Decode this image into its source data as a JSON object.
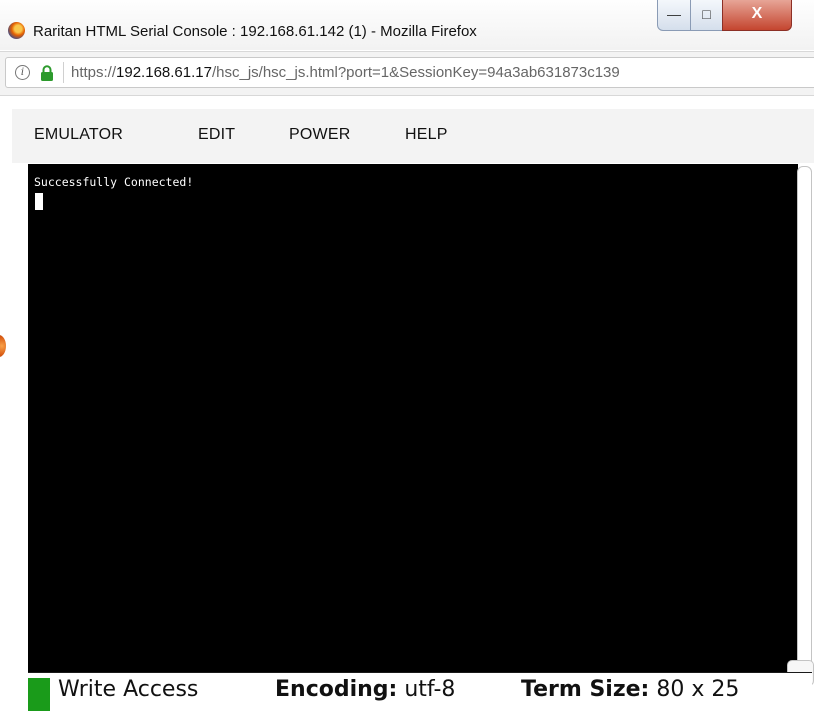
{
  "window": {
    "title": "Raritan HTML Serial Console : 192.168.61.142 (1) - Mozilla Firefox",
    "icon": "firefox-icon",
    "buttons": {
      "minimize": "—",
      "maximize": "□",
      "close": "X"
    }
  },
  "address_bar": {
    "scheme": "https://",
    "host": "192.168.61.17",
    "path": "/hsc_js/hsc_js.html?port=1&SessionKey=94a3ab631873c139"
  },
  "menu": {
    "items": [
      {
        "id": "emulator",
        "label": "EMULATOR"
      },
      {
        "id": "edit",
        "label": "EDIT"
      },
      {
        "id": "power",
        "label": "POWER"
      },
      {
        "id": "help",
        "label": "HELP"
      }
    ]
  },
  "terminal": {
    "output": "Successfully Connected!",
    "background": "#000000",
    "foreground": "#ffffff"
  },
  "status_bar": {
    "indicator_color": "#1a9b1a",
    "access": "Write Access",
    "encoding_label": "Encoding:",
    "encoding_value": "utf-8",
    "term_size_label": "Term Size:",
    "term_size_value": "80 x 25"
  }
}
